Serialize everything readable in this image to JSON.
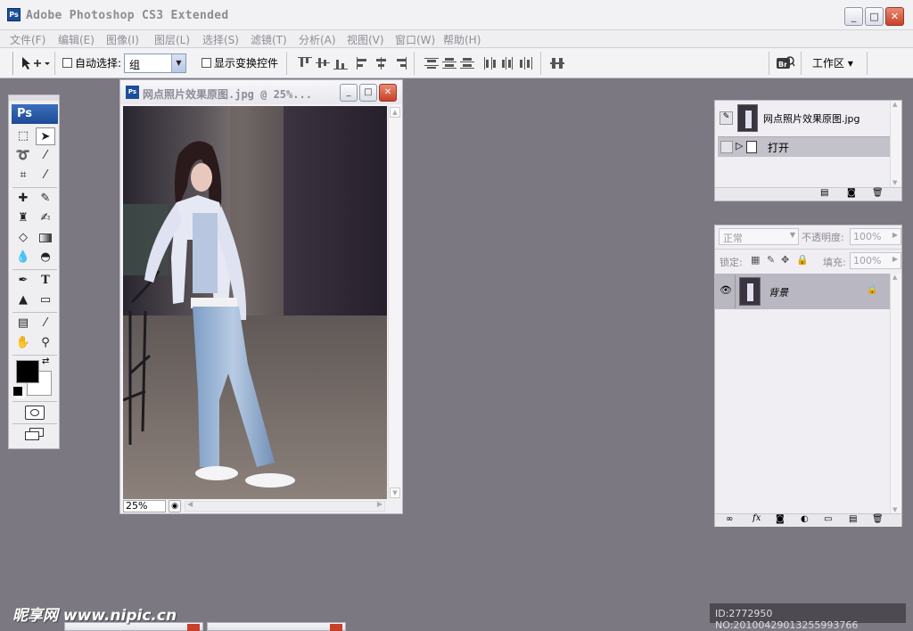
{
  "app": {
    "title": "Adobe Photoshop CS3 Extended",
    "icon_label": "Ps"
  },
  "window_controls": {
    "minimize": "_",
    "maximize": "□",
    "close": "✕"
  },
  "menubar": {
    "items": [
      "文件(F)",
      "编辑(E)",
      "图像(I)",
      "图层(L)",
      "选择(S)",
      "滤镜(T)",
      "分析(A)",
      "视图(V)",
      "窗口(W)",
      "帮助(H)"
    ]
  },
  "options_bar": {
    "auto_select_label": "自动选择:",
    "auto_select_value": "组",
    "show_transform_label": "显示变换控件",
    "workspace_label": "工作区 ▾"
  },
  "toolbox": {
    "logo": "Ps",
    "tools": [
      "marquee-tool",
      "move-tool",
      "lasso-tool",
      "magic-wand-tool",
      "crop-tool",
      "slice-tool",
      "healing-brush-tool",
      "brush-tool",
      "clone-stamp-tool",
      "history-brush-tool",
      "eraser-tool",
      "gradient-tool",
      "blur-tool",
      "dodge-tool",
      "pen-tool",
      "type-tool",
      "path-selection-tool",
      "shape-tool",
      "notes-tool",
      "eyedropper-tool",
      "hand-tool",
      "zoom-tool"
    ],
    "foreground_color": "#000000",
    "background_color": "#ffffff"
  },
  "document": {
    "title": "网点照片效果原图.jpg @ 25%...",
    "icon_label": "Ps",
    "zoom": "25%"
  },
  "history_panel": {
    "snapshot_name": "网点照片效果原图.jpg",
    "state": "打开"
  },
  "layers_panel": {
    "blend_mode": "正常",
    "opacity_label": "不透明度:",
    "opacity_value": "100%",
    "lock_label": "锁定:",
    "fill_label": "填充:",
    "fill_value": "100%",
    "layers": [
      {
        "name": "背景",
        "locked": true,
        "visible": true
      }
    ]
  },
  "footer": {
    "watermark": "昵享网 www.nipic.cn",
    "image_id": "ID:2772950 NO:20100429013255993766"
  }
}
